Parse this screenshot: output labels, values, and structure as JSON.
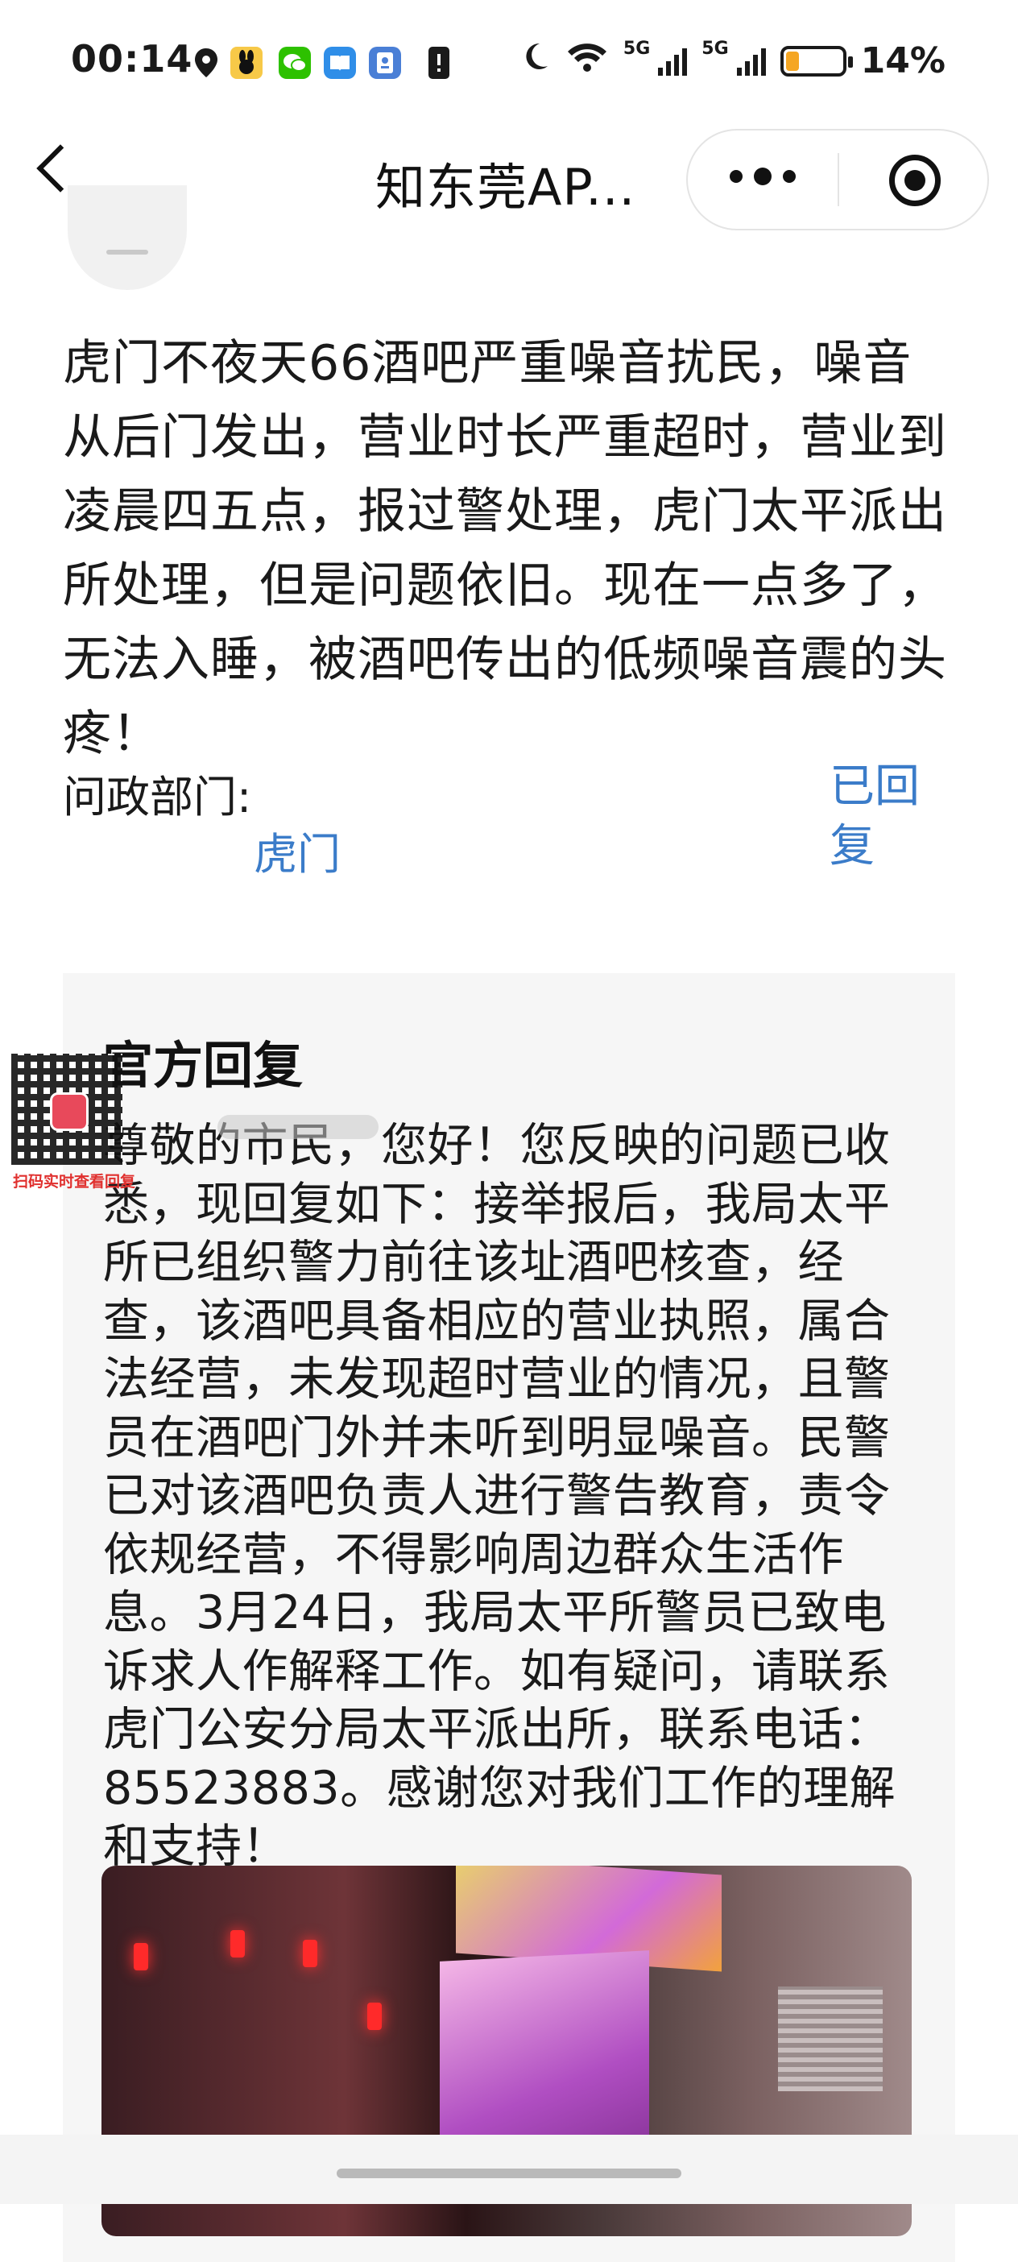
{
  "status_bar": {
    "time": "00:14",
    "network_1": "5G",
    "network_2": "5G",
    "battery_percent": "14%",
    "battery_level": 0.14,
    "icons": [
      "location-icon",
      "app-icon",
      "wechat-icon",
      "book-icon",
      "notes-icon",
      "warning-icon",
      "moon-icon",
      "wifi-icon"
    ]
  },
  "nav": {
    "title": "知东莞AP...",
    "icons": [
      "back-icon",
      "more-icon",
      "target-icon"
    ]
  },
  "post": {
    "content": "虎门不夜天66酒吧严重噪音扰民，噪音从后门发出，营业时长严重超时，营业到凌晨四五点，报过警处理，虎门太平派出所处理，但是问题依旧。现在一点多了，无法入睡，被酒吧传出的低频噪音震的头疼！",
    "dept_label": "问政部门:",
    "dept_value": "虎门",
    "status": "已回复"
  },
  "reply": {
    "title": "官方回复",
    "content": "尊敬的市民，您好！您反映的问题已收悉，现回复如下：接举报后，我局太平所已组织警力前往该址酒吧核查，经查，该酒吧具备相应的营业执照，属合法经营，未发现超时营业的情况，且警员在酒吧门外并未听到明显噪音。民警已对该酒吧负责人进行警告教育，责令依规经营，不得影响周边群众生活作息。3月24日，我局太平所警员已致电诉求人作解释工作。如有疑问，请联系虎门公安分局太平派出所，联系电话： 85523883。感谢您对我们工作的理解和支持！"
  },
  "overlay": {
    "qr_caption": "扫码实时查看回复"
  },
  "colors": {
    "link_blue": "#3b7cc9",
    "card_bg": "#f6f6f6",
    "battery_orange": "#f5a623"
  }
}
